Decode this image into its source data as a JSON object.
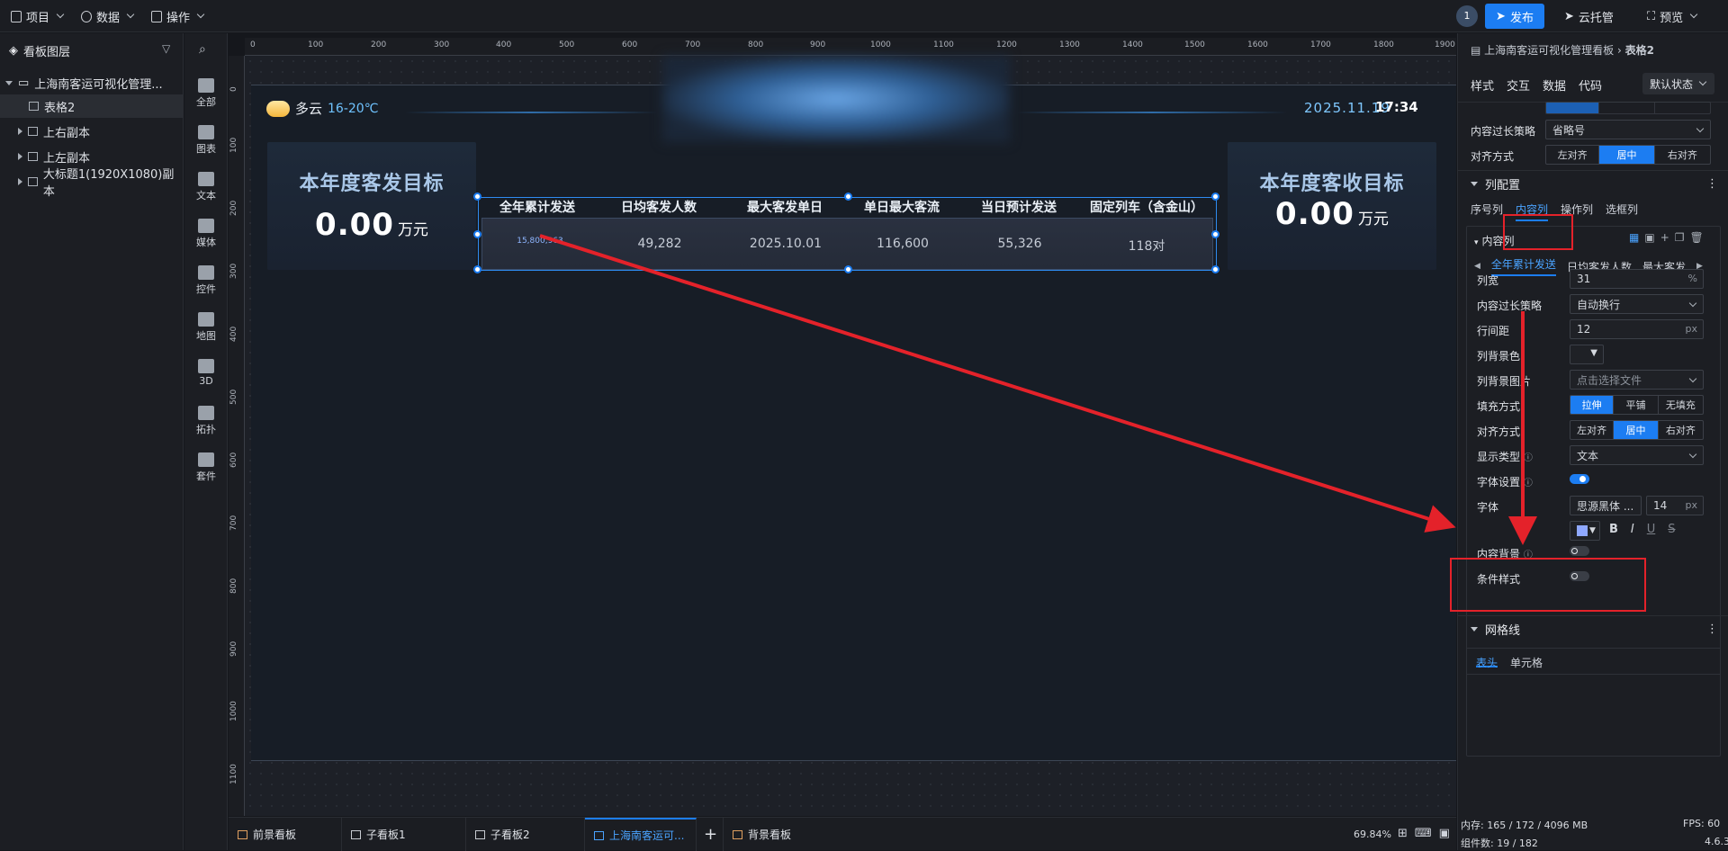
{
  "topbar": {
    "menus": [
      "项目",
      "数据",
      "操作"
    ],
    "badge": "1",
    "publish": "发布",
    "cloud": "云托管",
    "preview": "预览"
  },
  "leftpanel": {
    "title": "看板图层",
    "layers": [
      {
        "label": "上海南客运可视化管理...",
        "level": 0,
        "expanded": true
      },
      {
        "label": "表格2",
        "level": 1,
        "selected": true
      },
      {
        "label": "上右副本",
        "level": 1
      },
      {
        "label": "上左副本",
        "level": 1
      },
      {
        "label": "大标题1(1920X1080)副本",
        "level": 1
      }
    ]
  },
  "components": [
    "全部",
    "图表",
    "文本",
    "媒体",
    "控件",
    "地图",
    "3D",
    "拓扑",
    "套件"
  ],
  "ruler": {
    "top": [
      "0",
      "100",
      "200",
      "300",
      "400",
      "500",
      "600",
      "700",
      "800",
      "900",
      "1000",
      "1100",
      "1200",
      "1300",
      "1400",
      "1500",
      "1600",
      "1700",
      "1800",
      "1900"
    ],
    "left": [
      "0",
      "100",
      "200",
      "300",
      "400",
      "500",
      "600",
      "700",
      "800",
      "900",
      "1000",
      "1100"
    ]
  },
  "dashboard": {
    "weather": "多云",
    "temp": "16-20℃",
    "date": "2025.11.19",
    "time": "17:34",
    "left_card": {
      "title": "本年度客发目标",
      "value": "0.00",
      "unit": "万元"
    },
    "right_card": {
      "title": "本年度客收目标",
      "value": "0.00",
      "unit": "万元"
    },
    "table": {
      "headers": [
        "全年累计发送",
        "日均客发人数",
        "最大客发单日",
        "单日最大客流",
        "当日预计发送",
        "固定列车（含金山）"
      ],
      "row": [
        "15,800,963",
        "49,282",
        "2025.10.01",
        "116,600",
        "55,326",
        "118对"
      ]
    }
  },
  "rightpanel": {
    "breadcrumb_root": "上海南客运可视化管理看板",
    "breadcrumb_sep": "›",
    "breadcrumb_leaf": "表格2",
    "tabs": [
      "样式",
      "交互",
      "数据",
      "代码"
    ],
    "state": "默认状态",
    "overflow_label": "内容过长策略",
    "overflow_value": "省略号",
    "align_label": "对齐方式",
    "align_options": [
      "左对齐",
      "居中",
      "右对齐"
    ],
    "column_config": "列配置",
    "col_tabs": [
      "序号列",
      "内容列",
      "操作列",
      "选框列"
    ],
    "content_col": "内容列",
    "col_subtabs": [
      "全年累计发送",
      "日均客发人数",
      "最大客发"
    ],
    "width_label": "列宽",
    "width_value": "31",
    "width_unit": "%",
    "wrap_label": "内容过长策略",
    "wrap_value": "自动换行",
    "line_label": "行间距",
    "line_value": "12",
    "line_unit": "px",
    "bgcolor_label": "列背景色",
    "bgimg_label": "列背景图片",
    "bgimg_value": "点击选择文件",
    "fill_label": "填充方式",
    "fill_options": [
      "拉伸",
      "平铺",
      "无填充"
    ],
    "align2_label": "对齐方式",
    "display_label": "显示类型",
    "display_value": "文本",
    "font_set_label": "字体设置",
    "font_label": "字体",
    "font_value": "思源黑体 ...",
    "font_size": "14",
    "font_unit": "px",
    "style_btns": [
      "B",
      "I",
      "U",
      "S"
    ],
    "content_bg_label": "内容背景",
    "cond_label": "条件样式",
    "grid_label": "网格线",
    "grid_tabs": [
      "表头",
      "单元格"
    ]
  },
  "bottombar": {
    "tabs": [
      "前景看板",
      "子看板1",
      "子看板2",
      "上海南客运可...",
      "背景看板"
    ],
    "plus": "+",
    "zoom": "69.84%",
    "memory": "内存: 165 / 172 / 4096 MB",
    "fps": "FPS: 60",
    "count": "组件数: 19 / 182",
    "version": "4.6.3"
  },
  "colors": {
    "accent": "#1c7df2",
    "annotation": "#e4222a"
  }
}
